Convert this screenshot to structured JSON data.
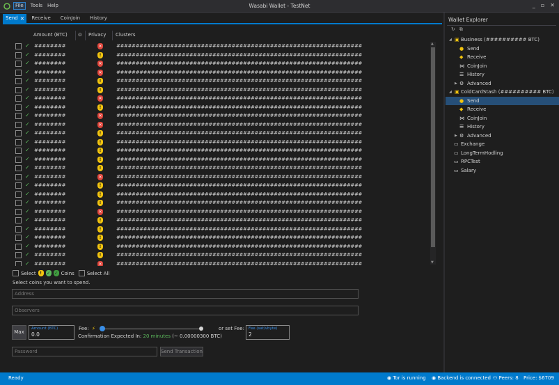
{
  "window": {
    "title": "Wasabi Wallet - TestNet"
  },
  "menu": {
    "file": "File",
    "tools": "Tools",
    "help": "Help"
  },
  "tabs": {
    "send": "Send",
    "receive": "Receive",
    "coinjoin": "CoinJoin",
    "history": "History"
  },
  "coin_list": {
    "headers": {
      "amount": "Amount (BTC)",
      "privacy": "Privacy",
      "clusters": "Clusters"
    },
    "amount_mask": "########",
    "cluster_mask": "################################################################",
    "rows": [
      {
        "privacy": "red"
      },
      {
        "privacy": "yellow"
      },
      {
        "privacy": "red"
      },
      {
        "privacy": "red"
      },
      {
        "privacy": "yellow"
      },
      {
        "privacy": "yellow"
      },
      {
        "privacy": "red"
      },
      {
        "privacy": "yellow"
      },
      {
        "privacy": "red"
      },
      {
        "privacy": "red"
      },
      {
        "privacy": "yellow"
      },
      {
        "privacy": "yellow"
      },
      {
        "privacy": "yellow"
      },
      {
        "privacy": "yellow"
      },
      {
        "privacy": "yellow"
      },
      {
        "privacy": "red"
      },
      {
        "privacy": "yellow"
      },
      {
        "privacy": "yellow"
      },
      {
        "privacy": "yellow"
      },
      {
        "privacy": "red"
      },
      {
        "privacy": "yellow"
      },
      {
        "privacy": "yellow"
      },
      {
        "privacy": "yellow"
      },
      {
        "privacy": "yellow"
      },
      {
        "privacy": "yellow"
      },
      {
        "privacy": "red"
      },
      {
        "privacy": "yellow"
      }
    ]
  },
  "select_bar": {
    "select": "Select",
    "coins": "Coins",
    "select_all": "Select All"
  },
  "hint": "Select coins you want to spend.",
  "inputs": {
    "address_placeholder": "Address",
    "observers_placeholder": "Observers",
    "password_placeholder": "Password"
  },
  "amount": {
    "max": "Max",
    "label": "Amount (BTC)",
    "value": "0.0"
  },
  "fee": {
    "label": "Fee:",
    "or_set": "or set Fee:",
    "rate_label": "Fee (sat/vbyte)",
    "rate_value": "2",
    "confirm_prefix": "Confirmation Expected In:",
    "confirm_time": "20 minutes",
    "confirm_suffix": "(~ 0.00000300 BTC)"
  },
  "send_button": "Send Transaction",
  "explorer": {
    "title": "Wallet Explorer",
    "wallets": [
      {
        "name": "Business (########## BTC)",
        "items": {
          "send": "Send",
          "receive": "Receive",
          "coinjoin": "CoinJoin",
          "history": "History",
          "advanced": "Advanced"
        }
      },
      {
        "name": "ColdCardStash (########## BTC)",
        "items": {
          "send": "Send",
          "receive": "Receive",
          "coinjoin": "CoinJoin",
          "history": "History",
          "advanced": "Advanced"
        }
      }
    ],
    "closed_wallets": [
      "Exchange",
      "LongTermHodling",
      "RPCTest",
      "Salary"
    ]
  },
  "status": {
    "ready": "Ready",
    "tor": "Tor is running",
    "backend": "Backend is connected",
    "peers": "Peers: 8",
    "price": "Price: $6709"
  },
  "colors": {
    "accent": "#007acc",
    "privacy_red": "#e0463c",
    "privacy_yellow": "#f2c40f",
    "privacy_green": "#5cb85c"
  }
}
